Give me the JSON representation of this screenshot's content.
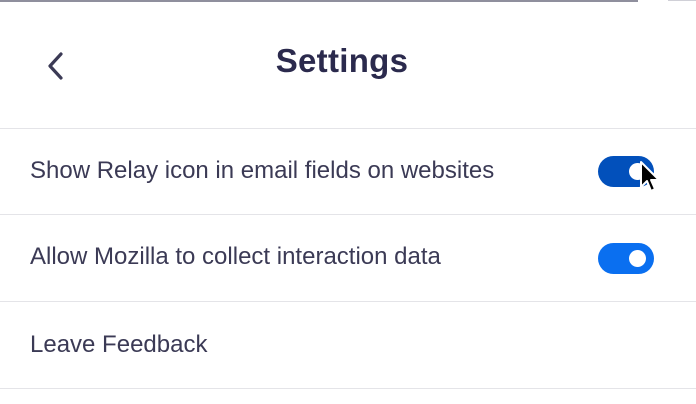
{
  "header": {
    "title": "Settings",
    "back_icon": "chevron-left-icon"
  },
  "settings": {
    "show_relay_icon": {
      "label": "Show Relay icon in email fields on websites",
      "enabled": true,
      "color": "#0250bb"
    },
    "collect_interaction_data": {
      "label": "Allow Mozilla to collect interaction data",
      "enabled": true,
      "color": "#0a6ff0"
    },
    "leave_feedback": {
      "label": "Leave Feedback"
    }
  },
  "colors": {
    "title": "#2b2a4d",
    "text": "#3b3a55",
    "divider": "#e4e4e8"
  }
}
